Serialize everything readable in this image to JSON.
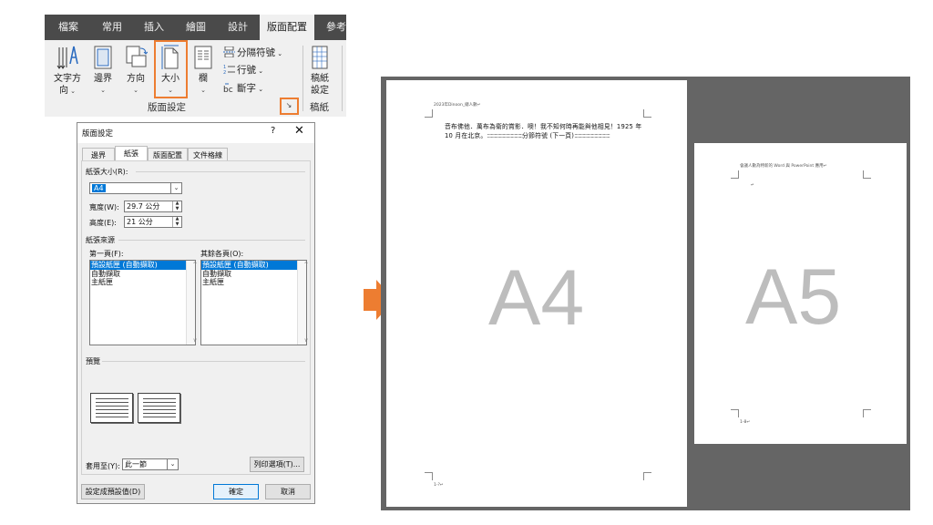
{
  "ribbon": {
    "tabs": [
      "檔案",
      "常用",
      "插入",
      "繪圖",
      "設計",
      "版面配置",
      "參考"
    ],
    "active_tab": "版面配置",
    "buttons": {
      "text_direction": [
        "文字方",
        "向"
      ],
      "margins": "邊界",
      "orientation": "方向",
      "size": "大小",
      "columns": "欄",
      "breaks": "分隔符號",
      "line_numbers": "行號",
      "hyphenation": "斷字",
      "manuscript": [
        "稿紙",
        "設定"
      ]
    },
    "group_labels": {
      "page_setup": "版面設定",
      "manuscript": "稿紙"
    }
  },
  "dialog": {
    "title": "版面設定",
    "help": "?",
    "close": "✕",
    "tabs": [
      "邊界",
      "紙張",
      "版面配置",
      "文件格線"
    ],
    "active_tab": "紙張",
    "paper_size_label": "紙張大小(R):",
    "paper_size_value": "A4",
    "width_label": "寬度(W):",
    "width_value": "29.7 公分",
    "height_label": "高度(E):",
    "height_value": "21 公分",
    "paper_source_label": "紙張來源",
    "first_page_label": "第一頁(F):",
    "other_pages_label": "其餘各頁(O):",
    "first_page_items": [
      "預設紙匣 (自動擷取)",
      "自動擷取",
      "主紙匣"
    ],
    "other_pages_items": [
      "預設紙匣 (自動擷取)",
      "自動擷取",
      "主紙匣"
    ],
    "preview_label": "預覽",
    "apply_to_label": "套用至(Y):",
    "apply_to_value": "此一節",
    "print_options": "列印選項(T)...",
    "set_default": "設定成預設值(D)",
    "ok": "確定",
    "cancel": "取消"
  },
  "document": {
    "page_a4": {
      "header": "2023年Dinoon_總人數↵",
      "line1": "音布佛他．萬布為衛的賞影．噢！我不知何時再能與他相見！1925 年",
      "line2_start": "10 月在北京。",
      "section_break": "分節符號 (下一頁)",
      "footer": "1-?↵",
      "label": "A4"
    },
    "page_a5": {
      "header": "會議人數為特新的 Word 與 PowerPoint 應用↵",
      "para_mark": "↵",
      "footer": "1-8↵",
      "label": "A5"
    }
  },
  "colors": {
    "accent": "#ed7d31",
    "selection": "#0078d7",
    "ribbon_tabbar": "#4a4a4a",
    "workspace": "#656565"
  }
}
